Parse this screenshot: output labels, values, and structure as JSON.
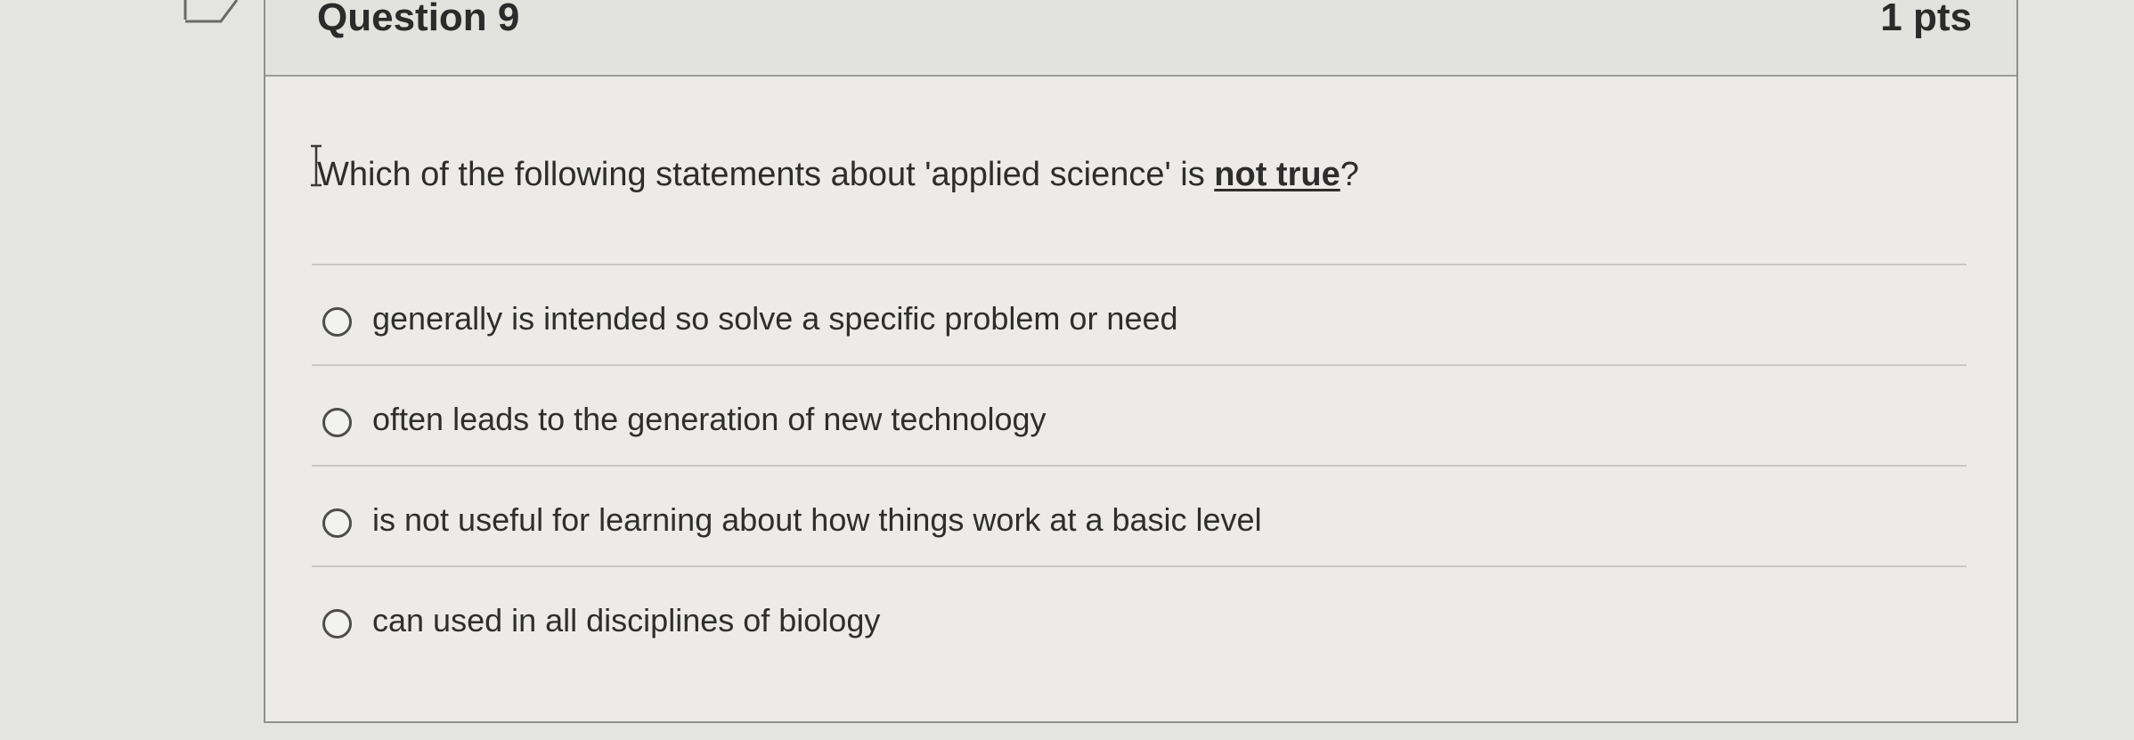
{
  "question": {
    "title": "Question 9",
    "points": "1 pts",
    "prompt_before": "Which of the following statements about 'applied science' is ",
    "prompt_emphasis": "not true",
    "prompt_after": "?"
  },
  "answers": [
    {
      "label": "generally is intended so solve a specific problem or need"
    },
    {
      "label": "often leads to the generation of new technology"
    },
    {
      "label": "is not useful for learning about how things work at a basic level"
    },
    {
      "label": "can used in all disciplines of biology"
    }
  ]
}
